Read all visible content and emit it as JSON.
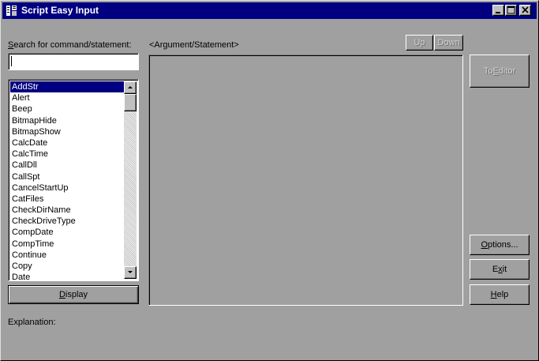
{
  "window": {
    "title": "Script Easy Input"
  },
  "search": {
    "label_accel": "S",
    "label_rest": "earch for command/statement:",
    "value": ""
  },
  "argument": {
    "label": "<Argument/Statement>",
    "up_label": "Up",
    "down_label": "Down",
    "text": ""
  },
  "commands": [
    "AddStr",
    "Alert",
    "Beep",
    "BitmapHide",
    "BitmapShow",
    "CalcDate",
    "CalcTime",
    "CallDll",
    "CallSpt",
    "CancelStartUp",
    "CatFiles",
    "CheckDirName",
    "CheckDriveType",
    "CompDate",
    "CompTime",
    "Continue",
    "Copy",
    "Date"
  ],
  "selected_command": "AddStr",
  "buttons": {
    "display_accel": "D",
    "display_rest": "isplay",
    "to_editor_pre": "To ",
    "to_editor_accel": "E",
    "to_editor_rest": "ditor",
    "options_accel": "O",
    "options_rest": "ptions...",
    "exit_pre": "E",
    "exit_accel": "x",
    "exit_rest": "it",
    "help_accel": "H",
    "help_rest": "elp"
  },
  "explanation": {
    "label": "Explanation:",
    "text": ""
  },
  "colors": {
    "titlebar": "#000080",
    "face": "#a0a0a0",
    "selection": "#000080"
  }
}
